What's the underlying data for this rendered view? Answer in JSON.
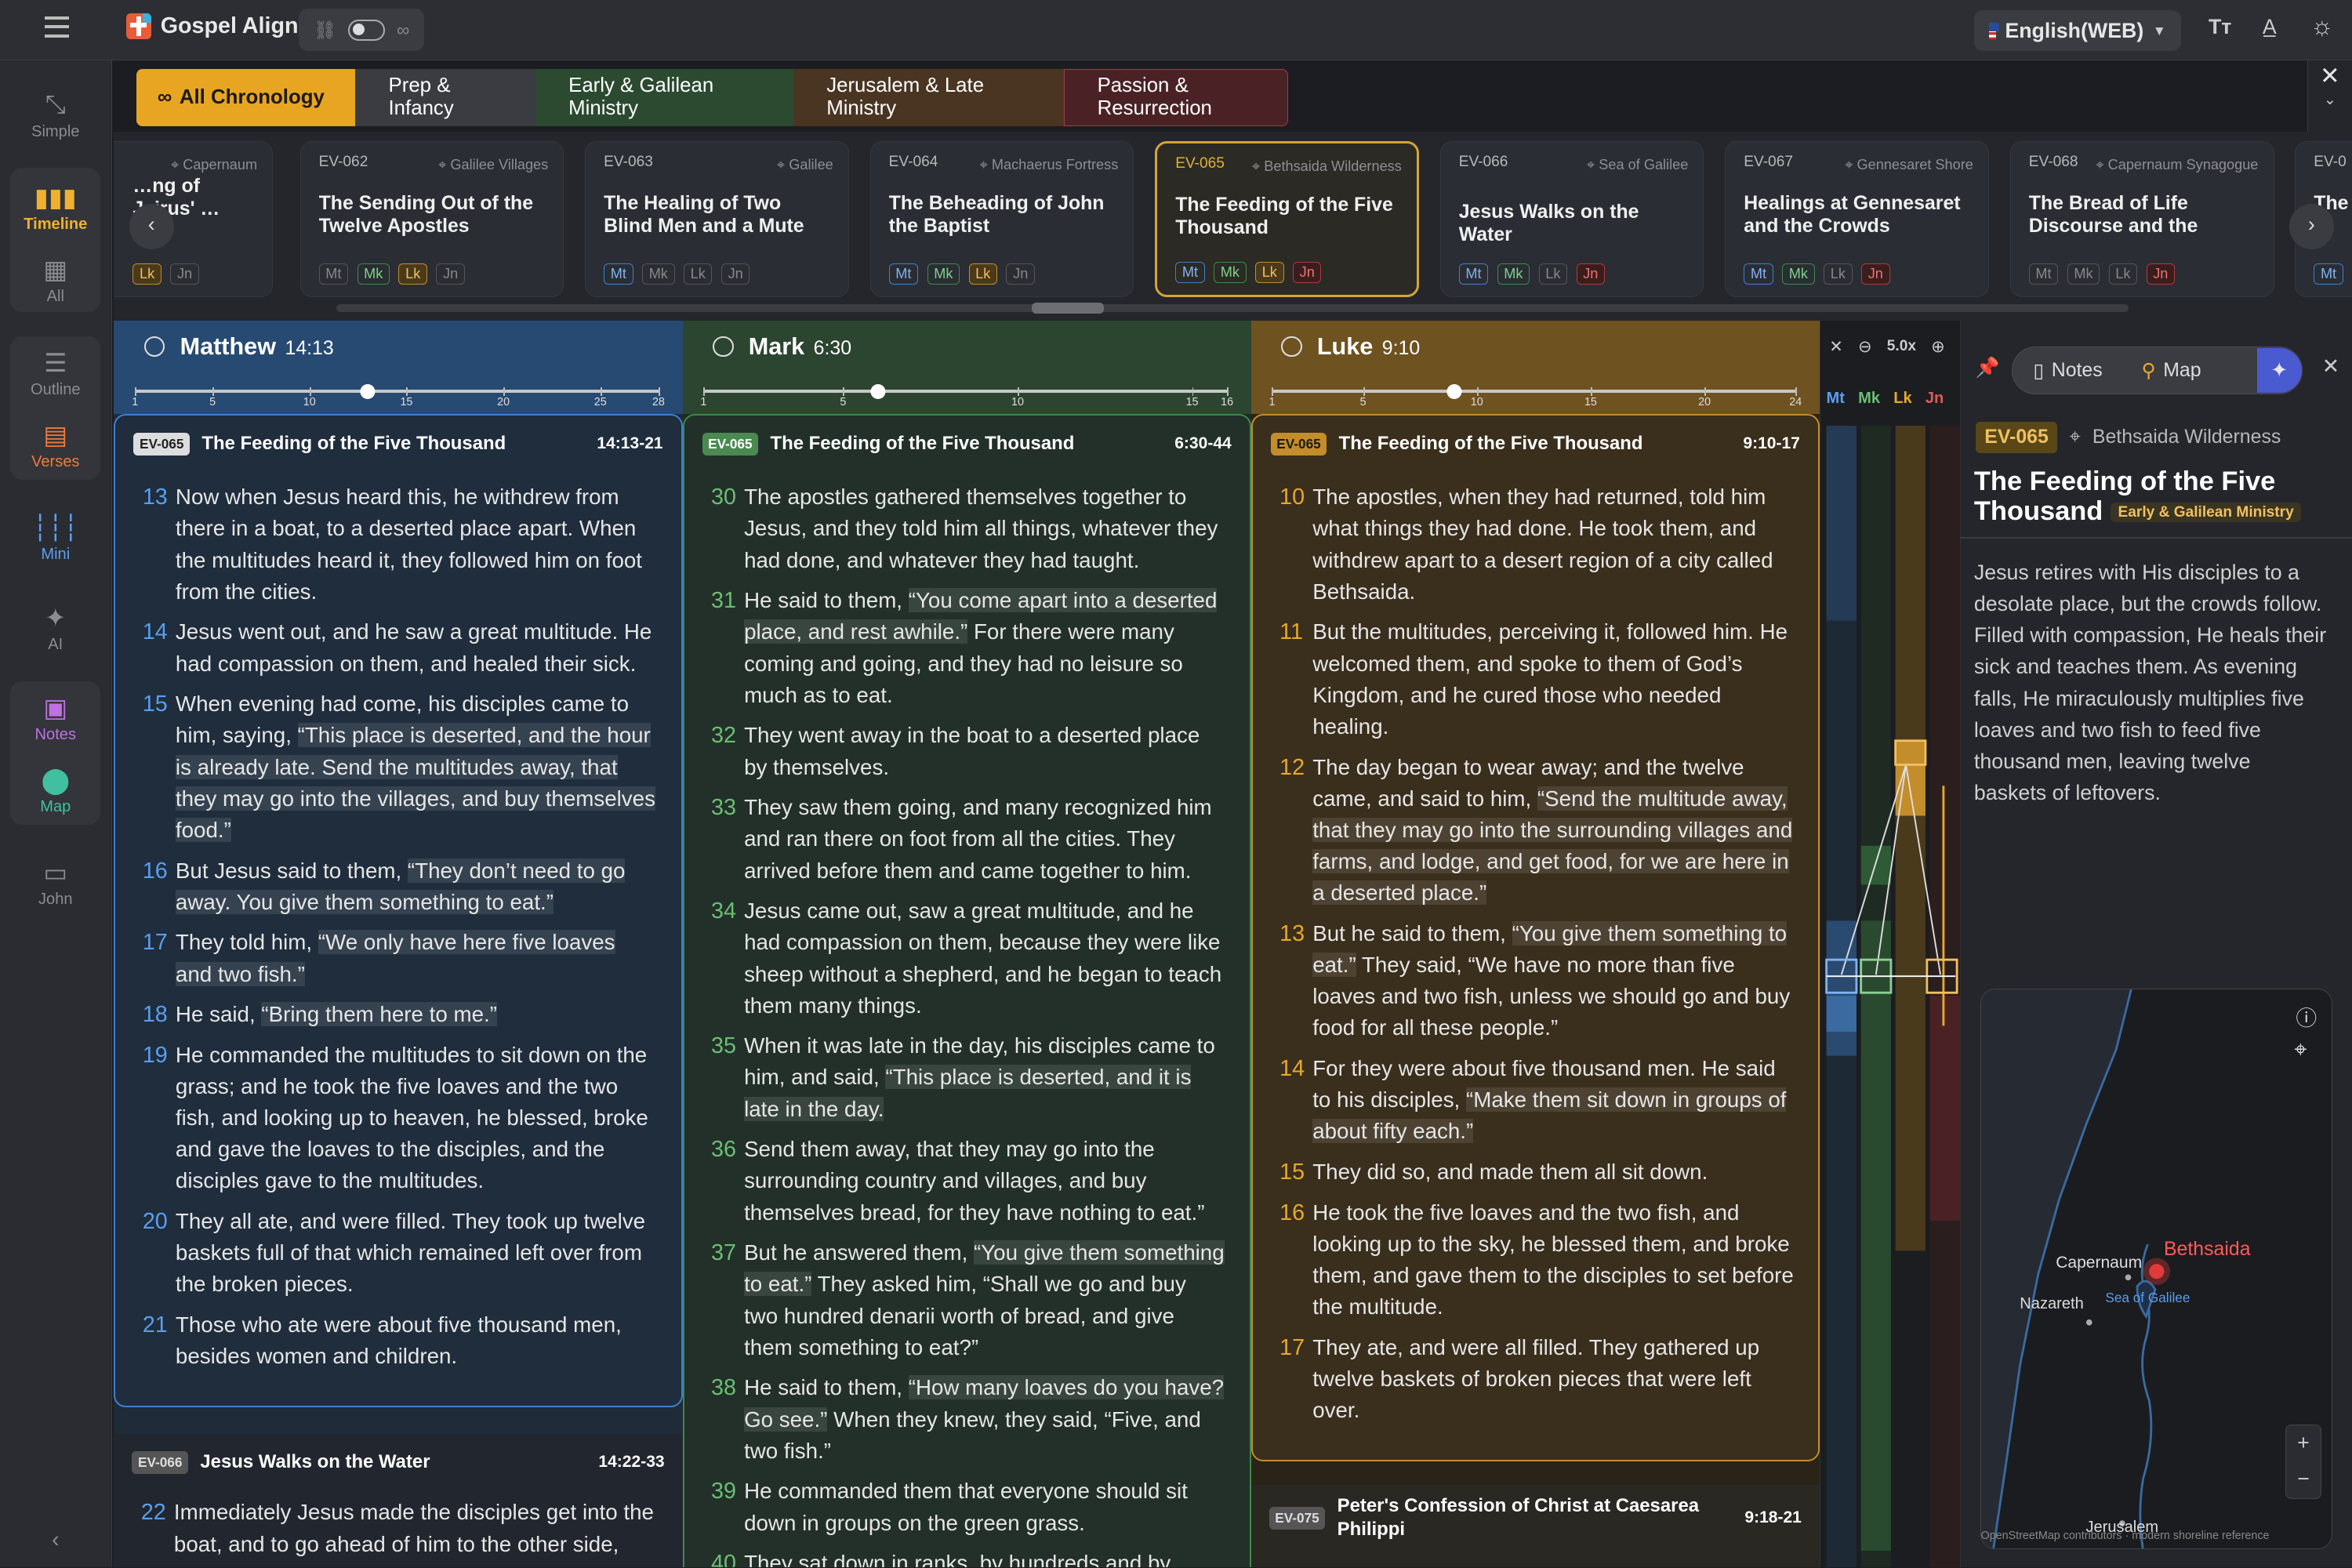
{
  "app": {
    "title": "Gospel Align",
    "language": "English(WEB)"
  },
  "rail": {
    "simple": "Simple",
    "timeline": "Timeline",
    "all": "All",
    "outline": "Outline",
    "verses": "Verses",
    "mini": "Mini",
    "ai": "AI",
    "notes": "Notes",
    "map": "Map",
    "john": "John"
  },
  "chronology": [
    "All Chronology",
    "Prep & Infancy",
    "Early & Galilean Ministry",
    "Jerusalem & Late Ministry",
    "Passion & Resurrection"
  ],
  "cards": [
    {
      "id": "",
      "loc": "Capernaum",
      "title": "…ng of Jairus' …ra…e Heali…",
      "b": [
        "",
        "",
        "Lk",
        "Jn"
      ]
    },
    {
      "id": "EV-062",
      "loc": "Galilee Villages",
      "title": "The Sending Out of the Twelve Apostles",
      "b": [
        "Mt",
        "Mk",
        "Lk",
        "Jn"
      ]
    },
    {
      "id": "EV-063",
      "loc": "Galilee",
      "title": "The Healing of Two Blind Men and a Mute Man, a…",
      "b": [
        "Mt",
        "Mk",
        "Lk",
        "Jn"
      ]
    },
    {
      "id": "EV-064",
      "loc": "Machaerus Fortress",
      "title": "The Beheading of John the Baptist",
      "b": [
        "Mt",
        "Mk",
        "Lk",
        "Jn"
      ]
    },
    {
      "id": "EV-065",
      "loc": "Bethsaida Wilderness",
      "title": "The Feeding of the Five Thousand",
      "b": [
        "Mt",
        "Mk",
        "Lk",
        "Jn"
      ]
    },
    {
      "id": "EV-066",
      "loc": "Sea of Galilee",
      "title": "Jesus Walks on the Water",
      "b": [
        "Mt",
        "Mk",
        "Lk",
        "Jn"
      ]
    },
    {
      "id": "EV-067",
      "loc": "Gennesaret Shore",
      "title": "Healings at Gennesaret and the Crowds Seekin…",
      "b": [
        "Mt",
        "Mk",
        "Lk",
        "Jn"
      ]
    },
    {
      "id": "EV-068",
      "loc": "Capernaum Synagogue",
      "title": "The Bread of Life Discourse and the Disci…",
      "b": [
        "Mt",
        "Mk",
        "Lk",
        "Jn"
      ]
    },
    {
      "id": "EV-0",
      "loc": "",
      "title": "The …de…",
      "b": [
        "Mt",
        "",
        "",
        ""
      ]
    }
  ],
  "matthew": {
    "name": "Matthew",
    "ref": "14:13",
    "ticks": [
      "1",
      "5",
      "10",
      "15",
      "20",
      "25",
      "28"
    ],
    "passage": {
      "id": "EV-065",
      "title": "The Feeding of the Five Thousand",
      "range": "14:13-21"
    },
    "verses": [
      {
        "n": "13",
        "t": "Now when Jesus heard this, he withdrew from there in a boat, to a deserted place apart. When the multitudes heard it, they followed him on foot from the cities."
      },
      {
        "n": "14",
        "t": "Jesus went out, and he saw a great multitude. He had compassion on them, and healed their sick."
      },
      {
        "n": "15",
        "t": "When evening had come, his disciples came to him, saying, “This place is deserted, and the hour is already late. Send the multitudes away, that they may go into the villages, and buy themselves food.”"
      },
      {
        "n": "16",
        "t": "But Jesus said to them, “They don’t need to go away. You give them something to eat.”"
      },
      {
        "n": "17",
        "t": "They told him, “We only have here five loaves and two fish.”"
      },
      {
        "n": "18",
        "t": "He said, “Bring them here to me.”"
      },
      {
        "n": "19",
        "t": "He commanded the multitudes to sit down on the grass; and he took the five loaves and the two fish, and looking up to heaven, he blessed, broke and gave the loaves to the disciples, and the disciples gave to the multitudes."
      },
      {
        "n": "20",
        "t": "They all ate, and were filled. They took up twelve baskets full of that which remained left over from the broken pieces."
      },
      {
        "n": "21",
        "t": "Those who ate were about five thousand men, besides women and children."
      }
    ],
    "next": {
      "id": "EV-066",
      "title": "Jesus Walks on the Water",
      "range": "14:22-33",
      "n": "22",
      "t": "Immediately Jesus made the disciples get into the boat, and to go ahead of him to the other side,"
    }
  },
  "mark": {
    "name": "Mark",
    "ref": "6:30",
    "ticks": [
      "1",
      "5",
      "10",
      "15",
      "16"
    ],
    "passage": {
      "id": "EV-065",
      "title": "The Feeding of the Five Thousand",
      "range": "6:30-44"
    },
    "verses": [
      {
        "n": "30",
        "t": "The apostles gathered themselves together to Jesus, and they told him all things, whatever they had done, and whatever they had taught."
      },
      {
        "n": "31",
        "t": "He said to them, “You come apart into a deserted place, and rest awhile.” For there were many coming and going, and they had no leisure so much as to eat."
      },
      {
        "n": "32",
        "t": "They went away in the boat to a deserted place by themselves."
      },
      {
        "n": "33",
        "t": "They saw them going, and many recognized him and ran there on foot from all the cities. They arrived before them and came together to him."
      },
      {
        "n": "34",
        "t": "Jesus came out, saw a great multitude, and he had compassion on them, because they were like sheep without a shepherd, and he began to teach them many things."
      },
      {
        "n": "35",
        "t": "When it was late in the day, his disciples came to him, and said, “This place is deserted, and it is late in the day."
      },
      {
        "n": "36",
        "t": "Send them away, that they may go into the surrounding country and villages, and buy themselves bread, for they have nothing to eat.”"
      },
      {
        "n": "37",
        "t": "But he answered them, “You give them something to eat.” They asked him, “Shall we go and buy two hundred denarii worth of bread, and give them something to eat?”"
      },
      {
        "n": "38",
        "t": "He said to them, “How many loaves do you have? Go see.” When they knew, they said, “Five, and two fish.”"
      },
      {
        "n": "39",
        "t": "He commanded them that everyone should sit down in groups on the green grass."
      },
      {
        "n": "40",
        "t": "They sat down in ranks, by hundreds and by fifties."
      }
    ]
  },
  "luke": {
    "name": "Luke",
    "ref": "9:10",
    "ticks": [
      "1",
      "5",
      "10",
      "15",
      "20",
      "24"
    ],
    "passage": {
      "id": "EV-065",
      "title": "The Feeding of the Five Thousand",
      "range": "9:10-17"
    },
    "verses": [
      {
        "n": "10",
        "t": "The apostles, when they had returned, told him what things they had done. He took them, and withdrew apart to a desert region of a city called Bethsaida."
      },
      {
        "n": "11",
        "t": "But the multitudes, perceiving it, followed him. He welcomed them, and spoke to them of God’s Kingdom, and he cured those who needed healing."
      },
      {
        "n": "12",
        "t": "The day began to wear away; and the twelve came, and said to him, “Send the multitude away, that they may go into the surrounding villages and farms, and lodge, and get food, for we are here in a deserted place.”"
      },
      {
        "n": "13",
        "t": "But he said to them, “You give them something to eat.” They said, “We have no more than five loaves and two fish, unless we should go and buy food for all these people.”"
      },
      {
        "n": "14",
        "t": "For they were about five thousand men. He said to his disciples, “Make them sit down in groups of about fifty each.”"
      },
      {
        "n": "15",
        "t": "They did so, and made them all sit down."
      },
      {
        "n": "16",
        "t": "He took the five loaves and the two fish, and looking up to the sky, he blessed them, and broke them, and gave them to the disciples to set before the multitude."
      },
      {
        "n": "17",
        "t": "They ate, and were all filled. They gathered up twelve baskets of broken pieces that were left over."
      }
    ],
    "next": {
      "id": "EV-075",
      "title": "Peter's Confession of Christ at Caesarea Philippi",
      "range": "9:18-21"
    }
  },
  "mini": {
    "zoom": "5.0x",
    "labels": [
      "Mt",
      "Mk",
      "Lk",
      "Jn"
    ]
  },
  "panel": {
    "notes": "Notes",
    "map": "Map",
    "id": "EV-065",
    "loc": "Bethsaida Wilderness",
    "title": "The Feeding of the Five Thousand",
    "tag": "Early & Galilean Ministry",
    "desc": "Jesus retires with His disciples to a desolate place, but the crowds follow. Filled with compassion, He heals their sick and teaches them. As evening falls, He miraculously multiplies five loaves and two fish to feed five thousand men, leaving twelve baskets of leftovers.",
    "map_labels": {
      "capernaum": "Capernaum",
      "bethsaida": "Bethsaida",
      "nazareth": "Nazareth",
      "sea": "Sea of Galilee",
      "jerusalem": "Jerusalem",
      "credit": "OpenStreetMap contributors · modern shoreline reference"
    }
  },
  "colors": {
    "matthew": "#274a73",
    "mark": "#2c4530",
    "luke": "#6e5220",
    "accent": "#e7a92a"
  }
}
